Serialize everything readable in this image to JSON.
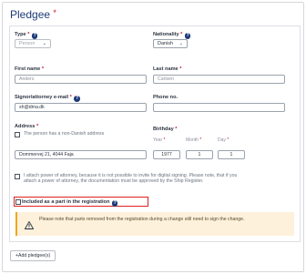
{
  "header": {
    "title": "Pledgee",
    "required_mark": "*"
  },
  "type": {
    "label": "Type",
    "required_mark": "*",
    "help_icon": "question-icon",
    "value": "Person"
  },
  "nationality": {
    "label": "Nationality",
    "required_mark": "*",
    "help_icon": "question-icon",
    "value": "Danish"
  },
  "first_name": {
    "label": "First name",
    "required_mark": "*",
    "value": "Anders"
  },
  "last_name": {
    "label": "Last name",
    "required_mark": "*",
    "value": "Carlsen"
  },
  "email": {
    "label": "Signor/attorney e-mail",
    "required_mark": "*",
    "help_icon": "question-icon",
    "value": "sh@dma.dk"
  },
  "phone": {
    "label": "Phone no.",
    "value": ""
  },
  "address": {
    "label": "Address",
    "required_mark": "*",
    "non_danish_checkbox": "The person has a non-Danish address",
    "value": "Dommervej 21, 4044 Faja"
  },
  "birthday": {
    "label": "Birthday",
    "required_mark": "*",
    "year_label": "Year",
    "month_label": "Month",
    "day_label": "Day",
    "year": "1977",
    "month": "1",
    "day": "1"
  },
  "power_of_attorney": {
    "text": "I attach power of attorney, because it is not possible to invite for digital signing. Please note, that if you attach a power of attorney, the documentation must be approved by the Ship Register."
  },
  "included": {
    "label": "Included as a part in the registration",
    "help_icon": "question-icon"
  },
  "warning": {
    "icon": "warning-icon",
    "text": "Please note that parts removed from the registration during a change still need to sign the change."
  },
  "add_button": {
    "label": "+Add pledgee(s)"
  },
  "colors": {
    "brand": "#1d3a78",
    "required": "#c8102e",
    "highlight": "#e02020",
    "warning_bg": "#fdf1dc",
    "warning_accent": "#f2a51a"
  }
}
